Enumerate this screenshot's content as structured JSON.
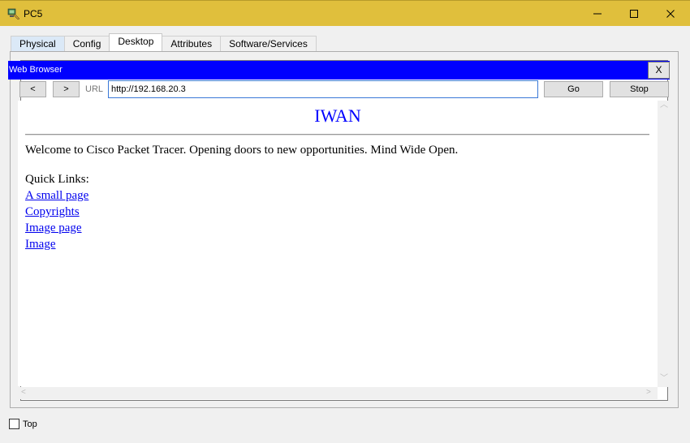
{
  "window": {
    "title": "PC5"
  },
  "tabs": [
    {
      "label": "Physical"
    },
    {
      "label": "Config"
    },
    {
      "label": "Desktop"
    },
    {
      "label": "Attributes"
    },
    {
      "label": "Software/Services"
    }
  ],
  "browser": {
    "title": "Web Browser",
    "close_label": "X",
    "back_label": "<",
    "forward_label": ">",
    "url_label": "URL",
    "url_value": "http://192.168.20.3",
    "go_label": "Go",
    "stop_label": "Stop"
  },
  "page": {
    "heading": "IWAN",
    "welcome": "Welcome to Cisco Packet Tracer. Opening doors to new opportunities. Mind Wide Open.",
    "quick_links_label": "Quick Links:",
    "links": [
      "A small page",
      "Copyrights",
      "Image page",
      "Image"
    ]
  },
  "footer": {
    "top_label": "Top",
    "top_checked": false
  },
  "colors": {
    "titlebar": "#e0bf3c",
    "browser_header": "#0000ff",
    "link": "#0000ee",
    "heading": "#0000ff"
  }
}
